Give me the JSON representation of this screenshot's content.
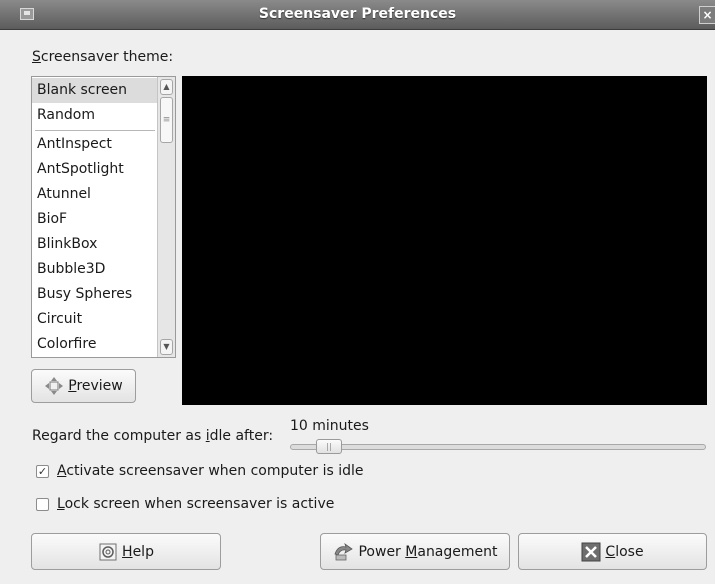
{
  "window": {
    "title": "Screensaver Preferences",
    "close_glyph": "×"
  },
  "theme_label": {
    "mnemonic": "S",
    "rest": "creensaver theme:"
  },
  "themes": {
    "items": [
      {
        "label": "Blank screen",
        "selected": true
      },
      {
        "label": "Random"
      },
      {
        "label": "AntInspect"
      },
      {
        "label": "AntSpotlight"
      },
      {
        "label": "Atunnel"
      },
      {
        "label": "BioF"
      },
      {
        "label": "BlinkBox"
      },
      {
        "label": "Bubble3D"
      },
      {
        "label": "Busy Spheres"
      },
      {
        "label": "Circuit"
      },
      {
        "label": "Colorfire"
      }
    ]
  },
  "preview_button": {
    "mnemonic": "P",
    "rest": "review",
    "icon": "preview-icon"
  },
  "idle": {
    "label_before": "Regard the computer as ",
    "mnemonic": "i",
    "label_after": "dle after:",
    "value": "10 minutes",
    "slider_position": 0.11
  },
  "options": {
    "activate": {
      "mnemonic": "A",
      "rest": "ctivate screensaver when computer is idle",
      "checked": true
    },
    "lock": {
      "mnemonic": "L",
      "rest": "ock screen when screensaver is active",
      "checked": false
    }
  },
  "buttons": {
    "help": {
      "mnemonic": "H",
      "rest": "elp",
      "icon": "help-icon"
    },
    "power": {
      "before": "Power ",
      "mnemonic": "M",
      "rest": "anagement",
      "icon": "power-management-icon"
    },
    "close": {
      "mnemonic": "C",
      "rest": "lose",
      "icon": "close-icon"
    }
  },
  "colors": {
    "preview_background": "#000000",
    "selected_row": "#dcdcdc"
  }
}
